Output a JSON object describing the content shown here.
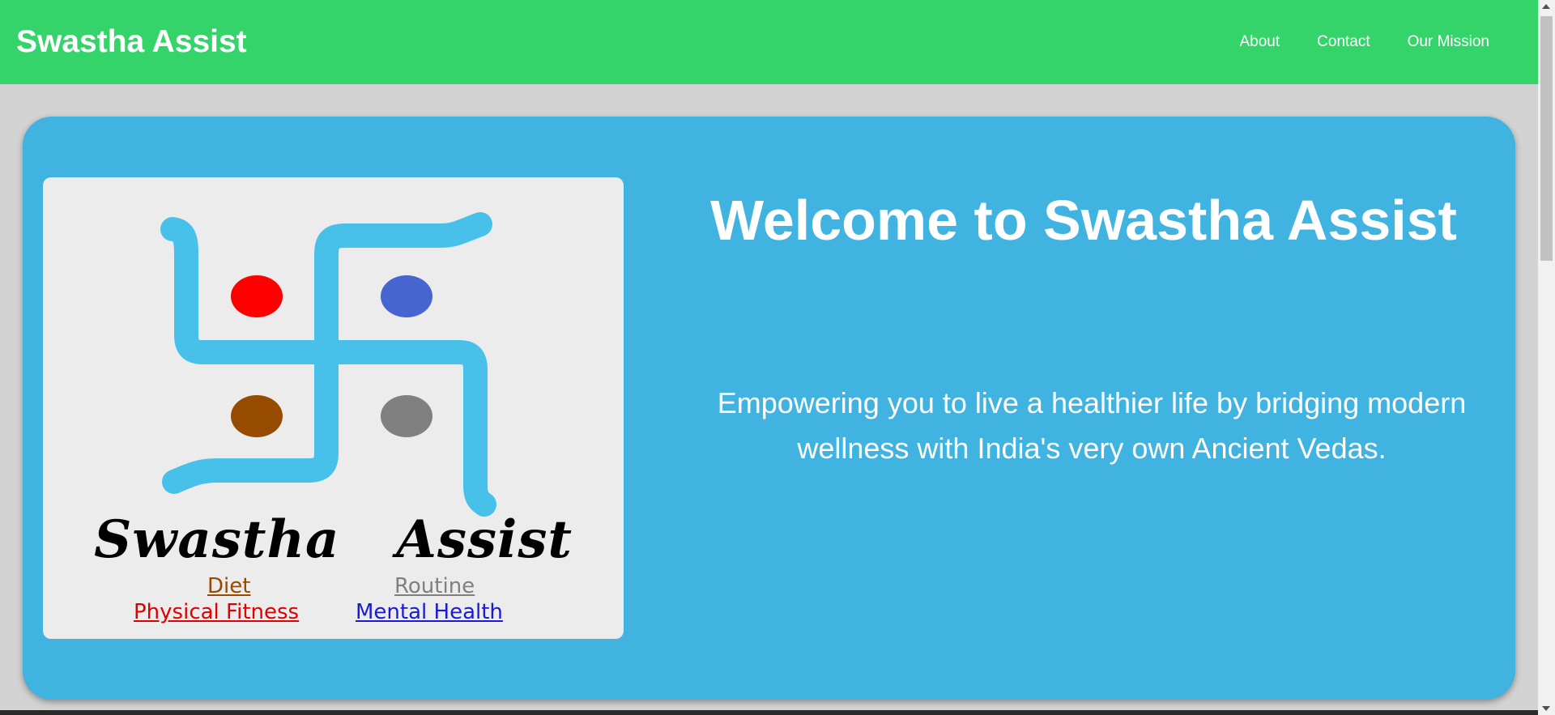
{
  "navbar": {
    "brand": "Swastha Assist",
    "links": [
      "About",
      "Contact",
      "Our Mission"
    ]
  },
  "logo": {
    "script_title": "Swastha   Assist",
    "pillars": {
      "diet": "Diet",
      "routine": "Routine",
      "physical_fitness": "Physical Fitness",
      "mental_health": "Mental Health"
    },
    "colors": {
      "symbol": "#48c1ea",
      "dot_red": "#ff0000",
      "dot_blue": "#4765d0",
      "dot_brown": "#964b00",
      "dot_gray": "#808080"
    }
  },
  "hero": {
    "title": "Welcome to Swastha Assist",
    "subtitle": "Empowering you to live a healthier life by bridging modern wellness with India's very own Ancient Vedas."
  },
  "colors": {
    "navbar_bg": "#35d46a",
    "hero_bg": "#41b3e0",
    "page_bg": "#d3d3d3"
  }
}
